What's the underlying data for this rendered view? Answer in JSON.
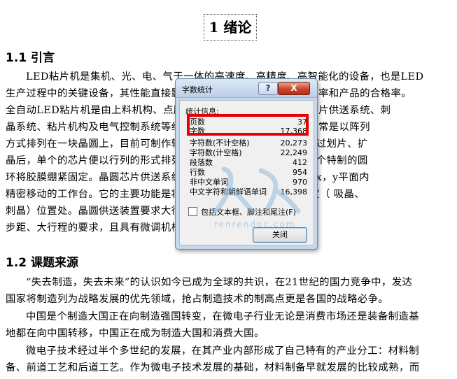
{
  "document": {
    "chapter_title": "1 绪论",
    "section1_heading": "1.1 引言",
    "section1_lines": [
      "LED粘片机是集机、光、电、气于一体的高速度、高精度、高智能化的设备，也是LED",
      "生产过程中的关键设备，其性能直接影响到LED的生产效率、生产效率和产品的合格率。",
      "全自动LED粘片机是由上料机构、点胶机构、芯片分离机构、晶圆芯片供送系统、刺",
      "晶系统、粘片机构及电气控制系统等组成。目前用于组成LED芯片通常是以阵列",
      "方式排列在一块晶圆上，目前可制作较大尺寸的芯片，晶圆进一步经过划片、扩",
      "晶后，单个的芯片便以行列的形式排列在晶圆上，吸取芯片，常用一个特制的圆",
      "环将胶膜绷紧固定。晶圆芯片供送系统的功能将晶圆固定圆环，可在x，y平面内",
      "精密移动的工作台。它的主要功能是将芯片按行或列的送到CCD标定（ 吸晶、",
      "刺晶）位置处。晶圆供送装置要求大行程，配合精度高，能够满足小",
      "步距、大行程的要求，且具有微调机构。"
    ],
    "section2_heading": "1.2 课题来源",
    "section2_lines": [
      "“失去制造，失去未来”的认识如今已成为全球的共识，在21世纪的国力竞争中，发达",
      "国家将制造列为战略发展的优先领域，抢占制造技术的制高点更是各国的战略必争。",
      "中国是个制造大国正在向制造强国转变，在微电子行业无论是消费市场还是装备制造基",
      "地都在向中国转移，中国正在成为制造大国和消费大国。",
      "微电子技术经过半个多世纪的发展，在其产业内部形成了自己特有的产业分工：材料制",
      "备、前道工艺和后道工艺。作为微电子技术发展的基础，材料制备早就发展的比较成熟，而"
    ]
  },
  "dialog": {
    "title": "字数统计",
    "help": "?",
    "close": "X",
    "group_label": "统计信息:",
    "stats": [
      {
        "label": "页数",
        "value": "37"
      },
      {
        "label": "字数",
        "value": "17,368"
      },
      {
        "label": "字符数(不计空格)",
        "value": "20,273"
      },
      {
        "label": "字符数(计空格)",
        "value": "22,249"
      },
      {
        "label": "段落数",
        "value": "412"
      },
      {
        "label": "行数",
        "value": "954"
      },
      {
        "label": "非中文单词",
        "value": "970"
      },
      {
        "label": "中文字符和朝鲜语单词",
        "value": "16,398"
      }
    ],
    "checkbox_label": "包括文本框、脚注和尾注(F)",
    "close_button": "关闭"
  },
  "watermark": {
    "text": "renrendoc.com"
  },
  "colors": {
    "highlight": "#e60000",
    "dialog_frame": "#c8d8ec",
    "close_button": "#c8442a"
  }
}
